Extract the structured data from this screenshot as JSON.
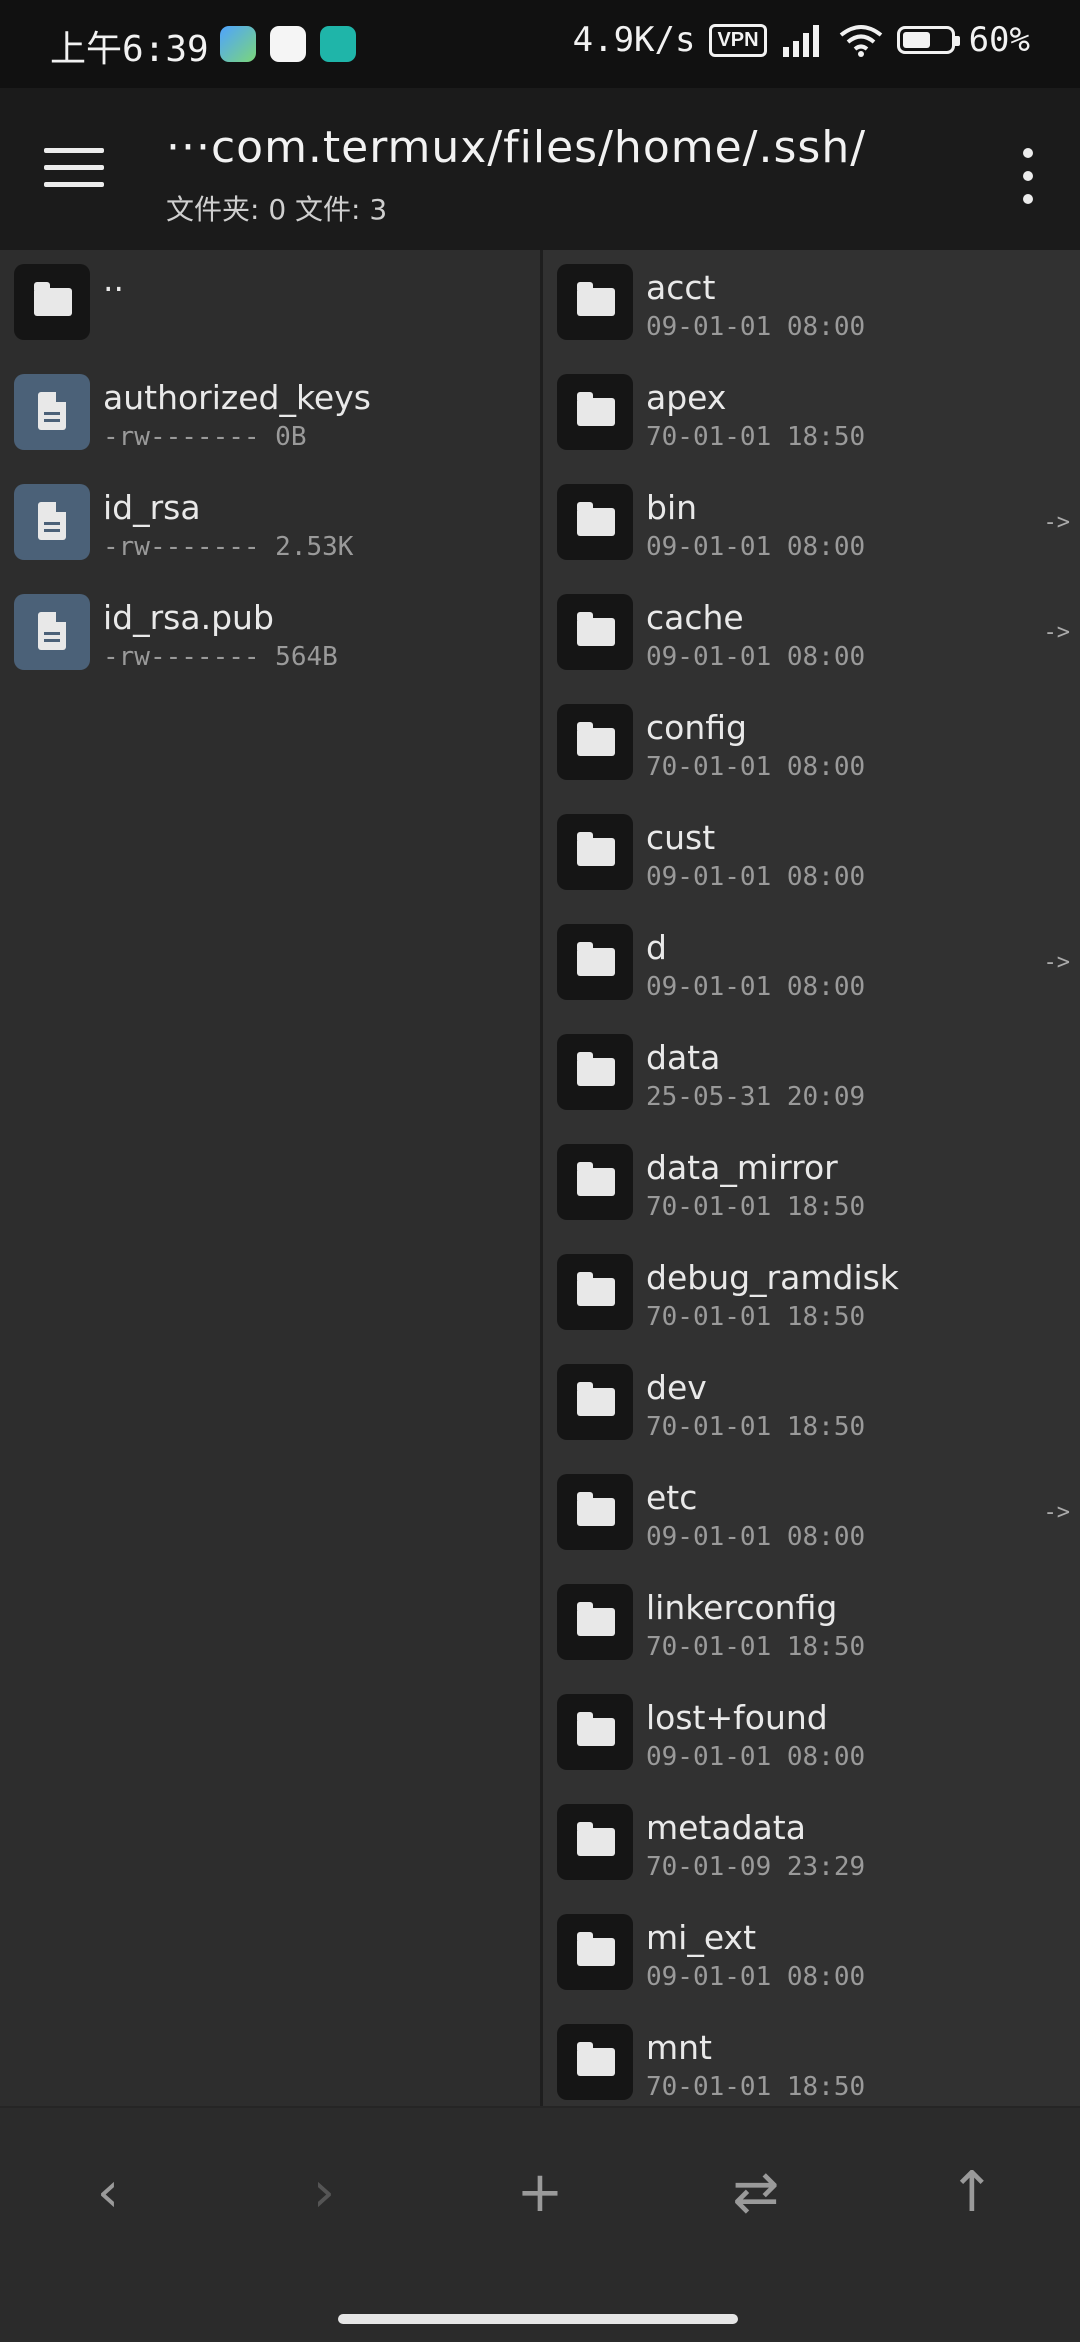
{
  "status": {
    "time": "上午6:39",
    "net_speed": "4.9K/s",
    "vpn": "VPN",
    "battery": "60%",
    "battery_level": 0.6
  },
  "appbar": {
    "path": "···com.termux/files/home/.ssh/",
    "counts": "文件夹: 0  文件: 3"
  },
  "left_pane": {
    "items": [
      {
        "name": "..",
        "meta": "",
        "type": "folder"
      },
      {
        "name": "authorized_keys",
        "meta": "-rw------- 0B",
        "type": "file"
      },
      {
        "name": "id_rsa",
        "meta": "-rw------- 2.53K",
        "type": "file"
      },
      {
        "name": "id_rsa.pub",
        "meta": "-rw------- 564B",
        "type": "file"
      }
    ]
  },
  "right_pane": {
    "items": [
      {
        "name": "acct",
        "meta": "09-01-01 08:00",
        "link": ""
      },
      {
        "name": "apex",
        "meta": "70-01-01 18:50",
        "link": ""
      },
      {
        "name": "bin",
        "meta": "09-01-01 08:00",
        "link": "->"
      },
      {
        "name": "cache",
        "meta": "09-01-01 08:00",
        "link": "->"
      },
      {
        "name": "config",
        "meta": "70-01-01 08:00",
        "link": ""
      },
      {
        "name": "cust",
        "meta": "09-01-01 08:00",
        "link": ""
      },
      {
        "name": "d",
        "meta": "09-01-01 08:00",
        "link": "->"
      },
      {
        "name": "data",
        "meta": "25-05-31 20:09",
        "link": ""
      },
      {
        "name": "data_mirror",
        "meta": "70-01-01 18:50",
        "link": ""
      },
      {
        "name": "debug_ramdisk",
        "meta": "70-01-01 18:50",
        "link": ""
      },
      {
        "name": "dev",
        "meta": "70-01-01 18:50",
        "link": ""
      },
      {
        "name": "etc",
        "meta": "09-01-01 08:00",
        "link": "->"
      },
      {
        "name": "linkerconfig",
        "meta": "70-01-01 18:50",
        "link": ""
      },
      {
        "name": "lost+found",
        "meta": "09-01-01 08:00",
        "link": ""
      },
      {
        "name": "metadata",
        "meta": "70-01-09 23:29",
        "link": ""
      },
      {
        "name": "mi_ext",
        "meta": "09-01-01 08:00",
        "link": ""
      },
      {
        "name": "mnt",
        "meta": "70-01-01 18:50",
        "link": ""
      }
    ]
  },
  "bottombar": {
    "back": "‹",
    "forward": "›",
    "add": "+",
    "swap": "⇄",
    "up": "↑"
  },
  "colors": {
    "statusbar_bg": "#111111",
    "appbar_bg": "#1b1b1b",
    "file_icon_bg": "#4b6178",
    "folder_icon_bg": "#151515"
  }
}
